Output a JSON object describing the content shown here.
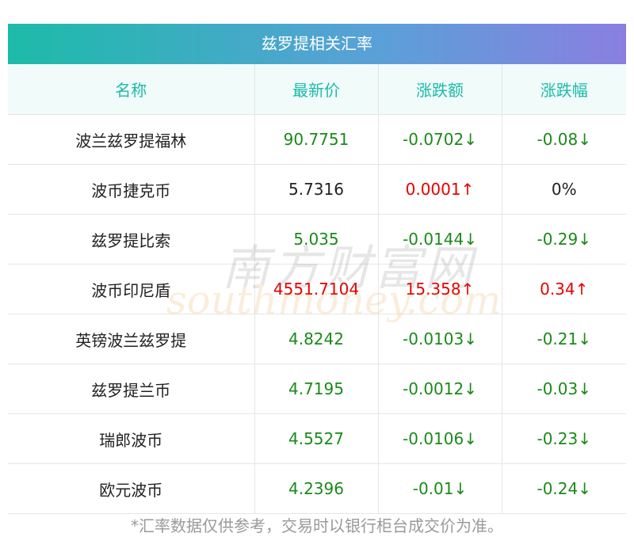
{
  "title": "兹罗提相关汇率",
  "headers": [
    "名称",
    "最新价",
    "涨跌额",
    "涨跌幅"
  ],
  "rows": [
    {
      "name": "波兰兹罗提福林",
      "price": "90.7751",
      "price_dir": "down",
      "change": "-0.0702↓",
      "change_dir": "down",
      "pct": "-0.08↓",
      "pct_dir": "down"
    },
    {
      "name": "波币捷克币",
      "price": "5.7316",
      "price_dir": "flat",
      "change": "0.0001↑",
      "change_dir": "up",
      "pct": "0%",
      "pct_dir": "flat"
    },
    {
      "name": "兹罗提比索",
      "price": "5.035",
      "price_dir": "down",
      "change": "-0.0144↓",
      "change_dir": "down",
      "pct": "-0.29↓",
      "pct_dir": "down"
    },
    {
      "name": "波币印尼盾",
      "price": "4551.7104",
      "price_dir": "up",
      "change": "15.358↑",
      "change_dir": "up",
      "pct": "0.34↑",
      "pct_dir": "up"
    },
    {
      "name": "英镑波兰兹罗提",
      "price": "4.8242",
      "price_dir": "down",
      "change": "-0.0103↓",
      "change_dir": "down",
      "pct": "-0.21↓",
      "pct_dir": "down"
    },
    {
      "name": "兹罗提兰币",
      "price": "4.7195",
      "price_dir": "down",
      "change": "-0.0012↓",
      "change_dir": "down",
      "pct": "-0.03↓",
      "pct_dir": "down"
    },
    {
      "name": "瑞郎波币",
      "price": "4.5527",
      "price_dir": "down",
      "change": "-0.0106↓",
      "change_dir": "down",
      "pct": "-0.23↓",
      "pct_dir": "down"
    },
    {
      "name": "欧元波币",
      "price": "4.2396",
      "price_dir": "down",
      "change": "-0.01↓",
      "change_dir": "down",
      "pct": "-0.24↓",
      "pct_dir": "down"
    }
  ],
  "note": "*汇率数据仅供参考，交易时以银行柜台成交价为准。",
  "watermark": {
    "cn": "南方财富网",
    "en": "southmoney.com"
  },
  "colors": {
    "up": "#e60000",
    "down": "#1a8a1a",
    "flat": "#222222",
    "header_text": "#1cbba9"
  }
}
